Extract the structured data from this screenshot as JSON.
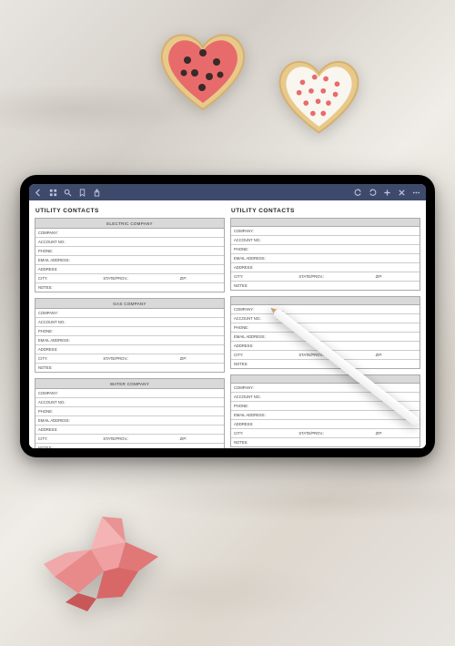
{
  "toolbar": {
    "icons": [
      "back",
      "grid",
      "search",
      "bookmark",
      "share",
      "undo",
      "redo",
      "add",
      "close",
      "more"
    ]
  },
  "document": {
    "pageTitle": "UTILITY CONTACTS",
    "fields": {
      "company": "COMPANY:",
      "account": "ACCOUNT NO.:",
      "phone": "PHONE:",
      "email": "EMAIL ADDRESS:",
      "address": "ADDRESS:",
      "city": "CITY:",
      "state": "STATE/PROV.:",
      "zip": "ZIP:",
      "notes": "NOTES:"
    },
    "leftSections": [
      {
        "header": "ELECTRIC COMPANY"
      },
      {
        "header": "GAS COMPANY"
      },
      {
        "header": "WATER COMPANY"
      }
    ],
    "rightSections": [
      {
        "header": ""
      },
      {
        "header": ""
      },
      {
        "header": ""
      }
    ]
  }
}
